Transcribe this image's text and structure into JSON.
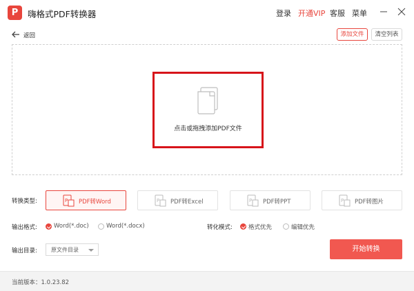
{
  "window": {
    "logo_letter": "P",
    "title": "嗨格式PDF转换器",
    "menu": {
      "login": "登录",
      "vip": "开通VIP",
      "service": "客服",
      "menu": "菜单"
    },
    "accent": "#e8453c"
  },
  "toolbar": {
    "back_label": "返回",
    "add_file": "添加文件",
    "clear_list": "清空列表"
  },
  "dropzone": {
    "label": "点击或拖拽添加PDF文件",
    "icon": "document-stack-icon"
  },
  "conversion": {
    "type_label": "转换类型:",
    "types": [
      {
        "label": "PDF转Word",
        "active": true
      },
      {
        "label": "PDF转Excel",
        "active": false
      },
      {
        "label": "PDF转PPT",
        "active": false
      },
      {
        "label": "PDF转图片",
        "active": false
      }
    ],
    "format_label": "输出格式:",
    "formats": [
      {
        "label": "Word(*.doc)",
        "checked": true
      },
      {
        "label": "Word(*.docx)",
        "checked": false
      }
    ],
    "mode_label": "转化模式:",
    "modes": [
      {
        "label": "格式优先",
        "checked": true
      },
      {
        "label": "编辑优先",
        "checked": false
      }
    ],
    "output_label": "输出目录:",
    "output_value": "原文件目录",
    "start_button": "开始转换"
  },
  "footer": {
    "version": "当前版本：1.0.23.82"
  }
}
